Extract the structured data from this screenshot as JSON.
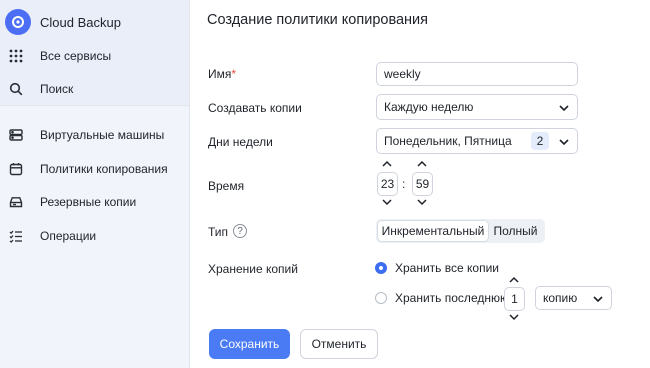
{
  "sidebar": {
    "brand": "Cloud Backup",
    "items": [
      {
        "label": "Все сервисы",
        "icon": "grid-icon"
      },
      {
        "label": "Поиск",
        "icon": "search-icon"
      },
      {
        "label": "Виртуальные машины",
        "icon": "server-icon"
      },
      {
        "label": "Политики копирования",
        "icon": "calendar-icon"
      },
      {
        "label": "Резервные копии",
        "icon": "disk-icon"
      },
      {
        "label": "Операции",
        "icon": "list-check-icon"
      }
    ]
  },
  "form": {
    "title": "Создание политики копирования",
    "name_label": "Имя",
    "name_required_mark": "*",
    "name_value": "weekly",
    "frequency_label": "Создавать копии",
    "frequency_value": "Каждую неделю",
    "days_label": "Дни недели",
    "days_value": "Понедельник, Пятница",
    "days_count": "2",
    "time_label": "Время",
    "time_hours": "23",
    "time_separator": ":",
    "time_minutes": "59",
    "type_label": "Тип",
    "type_help": "?",
    "type_options": [
      "Инкрементальный",
      "Полный"
    ],
    "type_selected": "Инкрементальный",
    "retention_label": "Хранение копий",
    "retention_keep_all": "Хранить все копии",
    "retention_keep_last": "Хранить последнюю",
    "retention_count": "1",
    "retention_unit": "копию",
    "retention_selected": "keep_all",
    "save_button": "Сохранить",
    "cancel_button": "Отменить"
  },
  "colors": {
    "accent": "#4b7af5",
    "required": "#e74c3c",
    "sidebar_bg": "#f1f4fa"
  }
}
